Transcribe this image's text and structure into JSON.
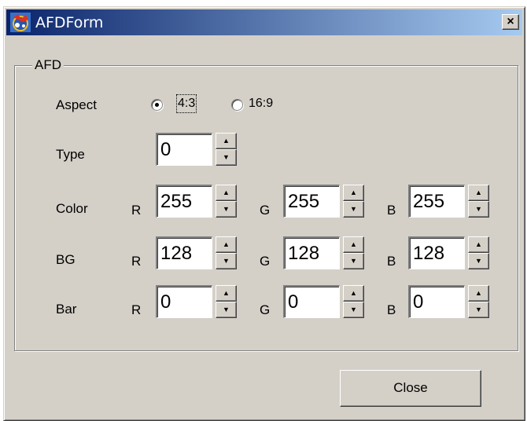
{
  "window": {
    "title": "AFDForm",
    "close_glyph": "×"
  },
  "group": {
    "label": "AFD"
  },
  "aspect": {
    "label": "Aspect",
    "options": [
      {
        "label": "4:3",
        "selected": true
      },
      {
        "label": "16:9",
        "selected": false
      }
    ]
  },
  "type": {
    "label": "Type",
    "value": "0"
  },
  "color": {
    "label": "Color",
    "r_label": "R",
    "g_label": "G",
    "b_label": "B",
    "r": "255",
    "g": "255",
    "b": "255"
  },
  "bg": {
    "label": "BG",
    "r_label": "R",
    "g_label": "G",
    "b_label": "B",
    "r": "128",
    "g": "128",
    "b": "128"
  },
  "bar": {
    "label": "Bar",
    "r_label": "R",
    "g_label": "G",
    "b_label": "B",
    "r": "0",
    "g": "0",
    "b": "0"
  },
  "spin_glyphs": {
    "up": "▲",
    "down": "▼"
  },
  "buttons": {
    "close": "Close"
  },
  "colors": {
    "face": "#d4d0c8",
    "title_start": "#0a246a",
    "title_end": "#a6caf0"
  }
}
